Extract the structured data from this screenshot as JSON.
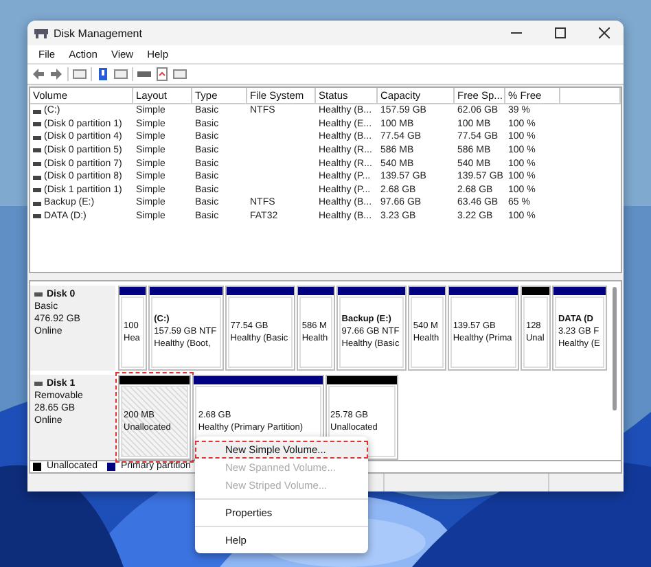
{
  "window": {
    "title": "Disk Management"
  },
  "menu": [
    "File",
    "Action",
    "View",
    "Help"
  ],
  "volumes": {
    "columns": [
      "Volume",
      "Layout",
      "Type",
      "File System",
      "Status",
      "Capacity",
      "Free Sp...",
      "% Free"
    ],
    "rows": [
      [
        "(C:)",
        "Simple",
        "Basic",
        "NTFS",
        "Healthy (B...",
        "157.59 GB",
        "62.06 GB",
        "39 %"
      ],
      [
        "(Disk 0 partition 1)",
        "Simple",
        "Basic",
        "",
        "Healthy (E...",
        "100 MB",
        "100 MB",
        "100 %"
      ],
      [
        "(Disk 0 partition 4)",
        "Simple",
        "Basic",
        "",
        "Healthy (B...",
        "77.54 GB",
        "77.54 GB",
        "100 %"
      ],
      [
        "(Disk 0 partition 5)",
        "Simple",
        "Basic",
        "",
        "Healthy (R...",
        "586 MB",
        "586 MB",
        "100 %"
      ],
      [
        "(Disk 0 partition 7)",
        "Simple",
        "Basic",
        "",
        "Healthy (R...",
        "540 MB",
        "540 MB",
        "100 %"
      ],
      [
        "(Disk 0 partition 8)",
        "Simple",
        "Basic",
        "",
        "Healthy (P...",
        "139.57 GB",
        "139.57 GB",
        "100 %"
      ],
      [
        "(Disk 1 partition 1)",
        "Simple",
        "Basic",
        "",
        "Healthy (P...",
        "2.68 GB",
        "2.68 GB",
        "100 %"
      ],
      [
        "Backup (E:)",
        "Simple",
        "Basic",
        "NTFS",
        "Healthy (B...",
        "97.66 GB",
        "63.46 GB",
        "65 %"
      ],
      [
        "DATA (D:)",
        "Simple",
        "Basic",
        "FAT32",
        "Healthy (B...",
        "3.23 GB",
        "3.22 GB",
        "100 %"
      ]
    ]
  },
  "disks": [
    {
      "name": "Disk 0",
      "type": "Basic",
      "size": "476.92 GB",
      "status": "Online",
      "partitions": [
        {
          "kind": "primary",
          "size": "100",
          "status": "Hea",
          "selected": false
        },
        {
          "kind": "primary",
          "label": "(C:)",
          "size": "157.59 GB NTF",
          "status": "Healthy (Boot,",
          "selected": false
        },
        {
          "kind": "primary",
          "size": "77.54 GB",
          "status": "Healthy (Basic",
          "selected": false
        },
        {
          "kind": "primary",
          "size": "586 M",
          "status": "Health",
          "selected": false
        },
        {
          "kind": "primary",
          "label": "Backup (E:)",
          "size": "97.66 GB NTF",
          "status": "Healthy (Basic",
          "selected": false
        },
        {
          "kind": "primary",
          "size": "540 M",
          "status": "Health",
          "selected": false
        },
        {
          "kind": "primary",
          "size": "139.57 GB",
          "status": "Healthy (Prima",
          "selected": false
        },
        {
          "kind": "unallocated",
          "size": "128",
          "status": "Unal",
          "selected": false
        },
        {
          "kind": "primary",
          "label": "DATA (D",
          "size": "3.23 GB F",
          "status": "Healthy (E",
          "selected": false
        }
      ]
    },
    {
      "name": "Disk 1",
      "type": "Removable",
      "size": "28.65 GB",
      "status": "Online",
      "partitions": [
        {
          "kind": "unallocated",
          "size": "200 MB",
          "status": "Unallocated",
          "selected": true
        },
        {
          "kind": "primary",
          "size": "2.68 GB",
          "status": "Healthy (Primary Partition)",
          "selected": false
        },
        {
          "kind": "unallocated",
          "size": "25.78 GB",
          "status": "Unallocated",
          "selected": false
        }
      ]
    }
  ],
  "legend": [
    {
      "label": "Unallocated",
      "color": "#000000"
    },
    {
      "label": "Primary partition",
      "color": "#000080"
    }
  ],
  "context_menu": [
    {
      "label": "New Simple Volume...",
      "disabled": false,
      "selected": true
    },
    {
      "label": "New Spanned Volume...",
      "disabled": true,
      "selected": false
    },
    {
      "label": "New Striped Volume...",
      "disabled": true,
      "selected": false
    },
    {
      "label": "Properties",
      "disabled": false,
      "selected": false,
      "separator_before": true
    },
    {
      "label": "Help",
      "disabled": false,
      "selected": false,
      "separator_before": true
    }
  ]
}
